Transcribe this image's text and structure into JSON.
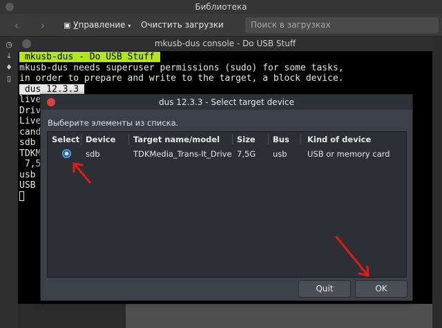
{
  "library": {
    "title": "Библиотека",
    "toolbar": {
      "manage_label": "Управление",
      "manage_underline": "У",
      "manage_rest": "правление",
      "clear_downloads_label": "Очистить загрузки",
      "search_placeholder": "Поиск в загрузках"
    },
    "sidebar_icons": [
      "history-icon",
      "download-icon",
      "tag-icon",
      "bookmarks-icon"
    ]
  },
  "console": {
    "title": "mkusb-dus console - Do USB Stuff",
    "banner": " mkusb-dus - Do USB Stuff ",
    "lines": [
      "mkusb-dus needs superuser permissions (sudo) for some tasks,",
      "in order to prepare and write to the target, a block device."
    ],
    "tab_label": " dus 12.3.3 ",
    "left_fragments": [
      "live",
      "Driv",
      "Live",
      "cand",
      "sdb",
      "TDKM",
      " 7,5",
      "usb",
      "USB"
    ]
  },
  "dialog": {
    "title": "dus 12.3.3 - Select target device",
    "prompt": "Выберите элементы из списка.",
    "columns": [
      "Select",
      "Device",
      "Target name/model",
      "Size",
      "Bus",
      "Kind of device"
    ],
    "rows": [
      {
        "selected": true,
        "device": "sdb",
        "model": "TDKMedia_Trans-It_Drive",
        "size": "7,5G",
        "bus": "usb",
        "kind": "USB or memory card"
      }
    ],
    "quit_label": "Quit",
    "ok_label": "OK"
  },
  "colors": {
    "annotation_arrow": "#e01b1b",
    "banner_green": "#b5e61d",
    "radio_blue": "#2f6fbf",
    "close_red": "#e0403a"
  }
}
